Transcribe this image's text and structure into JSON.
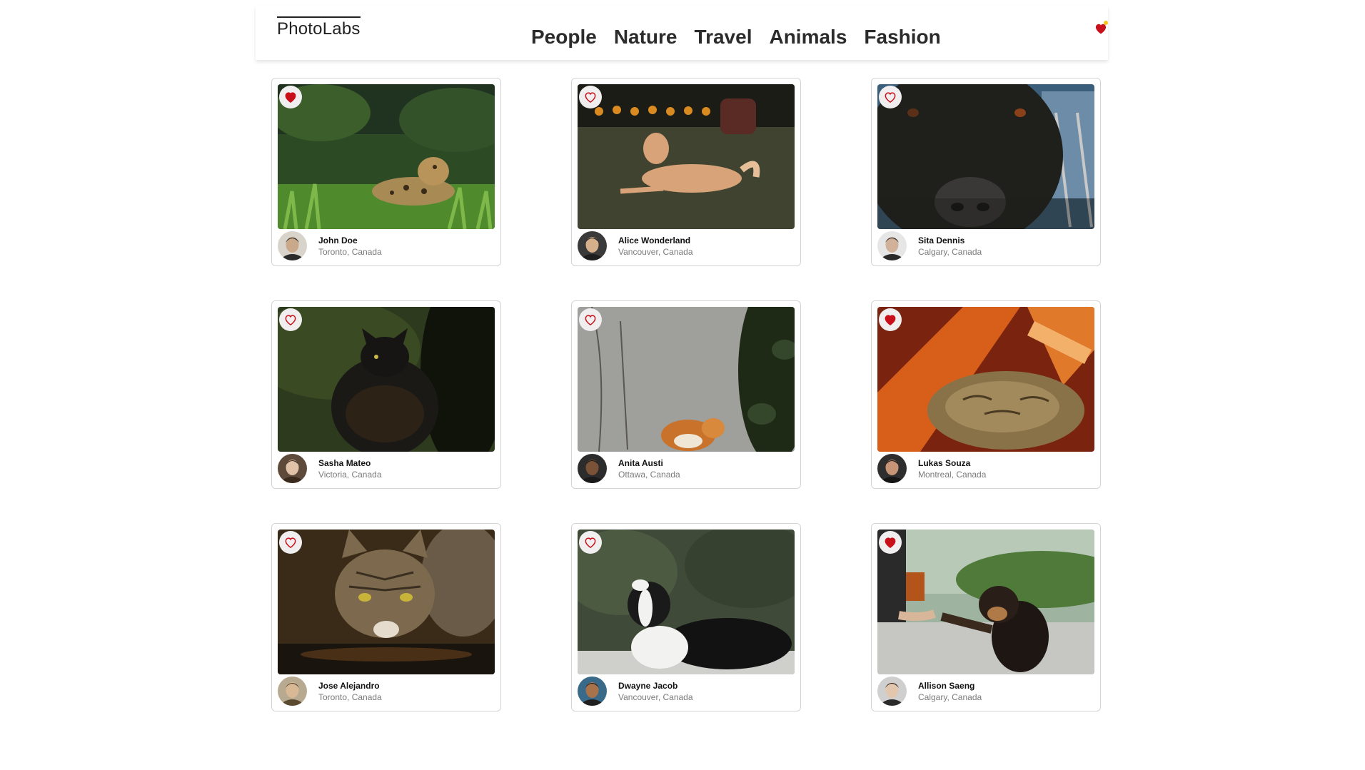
{
  "brand": "PhotoLabs",
  "topics": [
    "People",
    "Nature",
    "Travel",
    "Animals",
    "Fashion"
  ],
  "colors": {
    "accent": "#c8101a",
    "notification": "#f5c21a",
    "text": "#2b2b2b",
    "muted": "#7a7a7a"
  },
  "nav": {
    "fav_icon": "heart-icon",
    "has_favourites": true
  },
  "photos": [
    {
      "name": "John Doe",
      "location": "Toronto, Canada",
      "liked": true,
      "subject": "jaguar"
    },
    {
      "name": "Alice Wonderland",
      "location": "Vancouver, Canada",
      "liked": false,
      "subject": "dog lying"
    },
    {
      "name": "Sita Dennis",
      "location": "Calgary, Canada",
      "liked": false,
      "subject": "dog face"
    },
    {
      "name": "Sasha Mateo",
      "location": "Victoria, Canada",
      "liked": false,
      "subject": "black cat"
    },
    {
      "name": "Anita Austi",
      "location": "Ottawa, Canada",
      "liked": false,
      "subject": "orange cat"
    },
    {
      "name": "Lukas Souza",
      "location": "Montreal, Canada",
      "liked": true,
      "subject": "sleeping cat"
    },
    {
      "name": "Jose Alejandro",
      "location": "Toronto, Canada",
      "liked": false,
      "subject": "tabby cat"
    },
    {
      "name": "Dwayne Jacob",
      "location": "Vancouver, Canada",
      "liked": false,
      "subject": "border collie"
    },
    {
      "name": "Allison Saeng",
      "location": "Calgary, Canada",
      "liked": true,
      "subject": "dog paw"
    }
  ]
}
